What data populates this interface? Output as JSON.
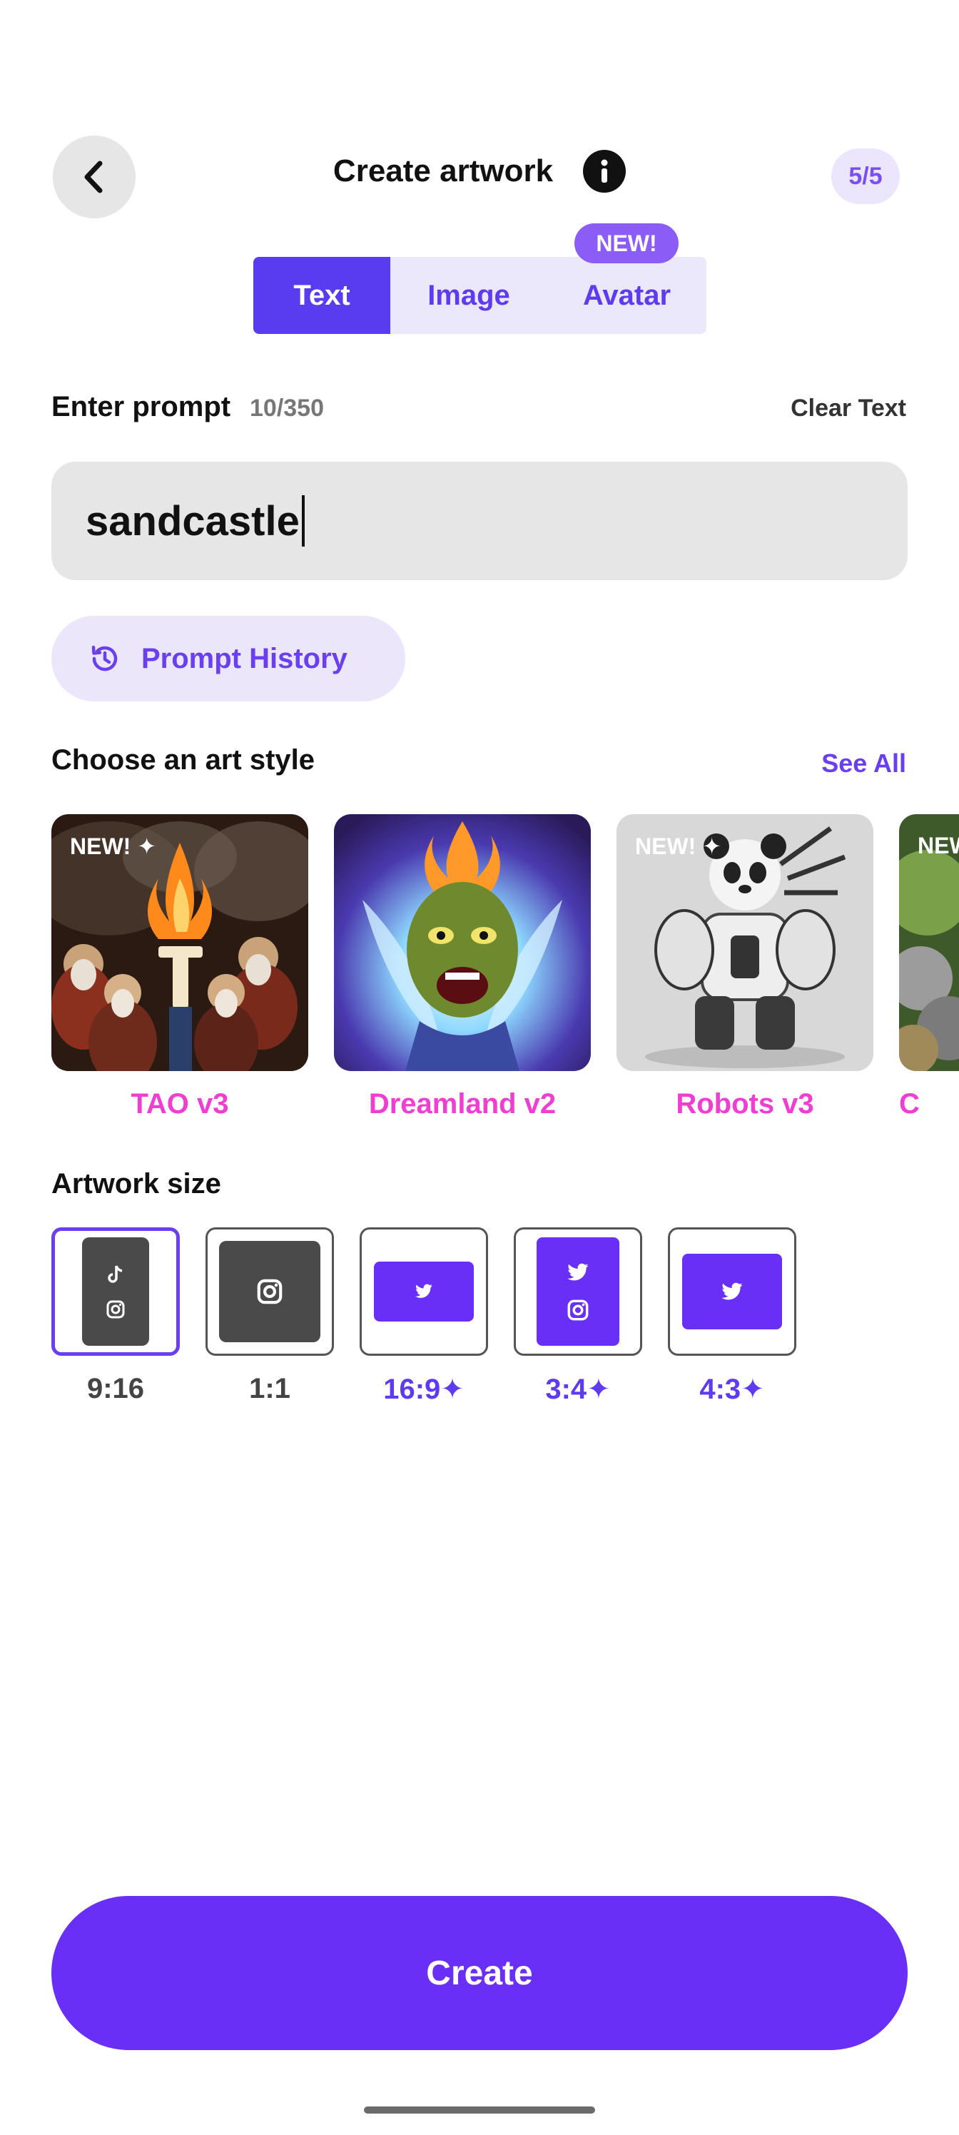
{
  "header": {
    "title": "Create artwork",
    "counter": "5/5",
    "back_icon": "chevron-left-icon",
    "info_icon": "info-icon"
  },
  "tabs": {
    "items": [
      {
        "label": "Text",
        "active": true
      },
      {
        "label": "Image",
        "active": false
      },
      {
        "label": "Avatar",
        "active": false
      }
    ],
    "new_badge": "NEW!"
  },
  "prompt": {
    "label": "Enter prompt",
    "count": "10/350",
    "clear_label": "Clear Text",
    "value": "sandcastle",
    "history_label": "Prompt History",
    "history_icon": "history-icon"
  },
  "art_style": {
    "title": "Choose an art style",
    "see_all": "See All",
    "items": [
      {
        "name": "TAO v3",
        "badge": "NEW! ✦"
      },
      {
        "name": "Dreamland v2",
        "badge": ""
      },
      {
        "name": "Robots v3",
        "badge": "NEW! ✦"
      },
      {
        "name": "C",
        "badge": "NEW"
      }
    ]
  },
  "artwork_size": {
    "title": "Artwork size",
    "items": [
      {
        "label": "9:16",
        "selected": true,
        "premium": false,
        "icons": [
          "tiktok-icon",
          "instagram-icon"
        ]
      },
      {
        "label": "1:1",
        "selected": false,
        "premium": false,
        "icons": [
          "instagram-icon"
        ]
      },
      {
        "label": "16:9✦",
        "selected": false,
        "premium": true,
        "icons": [
          "twitter-icon"
        ]
      },
      {
        "label": "3:4✦",
        "selected": false,
        "premium": true,
        "icons": [
          "twitter-icon",
          "instagram-icon"
        ]
      },
      {
        "label": "4:3✦",
        "selected": false,
        "premium": true,
        "icons": [
          "twitter-icon"
        ]
      }
    ]
  },
  "create_label": "Create",
  "colors": {
    "accent": "#6a2ff7",
    "tab_active": "#5a3cf0",
    "style_name": "#ee3fd0",
    "dark_tile": "#4a4a4a"
  }
}
